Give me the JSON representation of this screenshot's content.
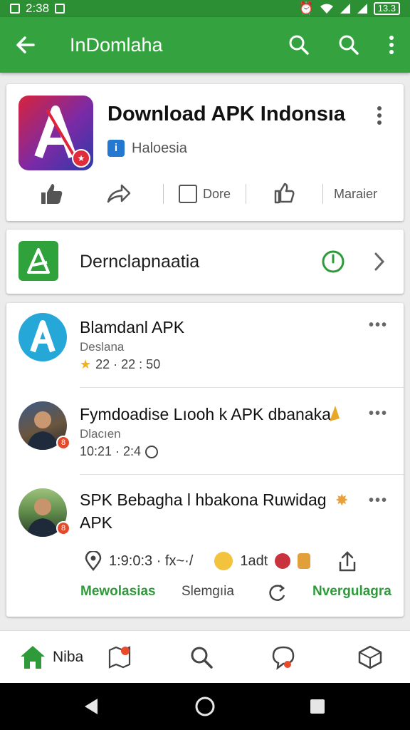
{
  "status_bar": {
    "time": "2:38",
    "battery": "13.3"
  },
  "app_bar": {
    "title": "InDomlaha"
  },
  "app_card": {
    "title": "Download APK Indonsıa",
    "subtitle": "Haloesia",
    "actions": [
      {
        "label": "Dore"
      },
      {
        "label": "Maraier"
      }
    ]
  },
  "link_row": {
    "label": "Dernclapnaatia"
  },
  "feed": [
    {
      "title": "Blamdanl APK",
      "subtitle": "Deslana",
      "meta": "22 · 22 : 50"
    },
    {
      "title": "Fymdoadise Lıooh k APK dbanaka",
      "subtitle": "Dlacıen",
      "meta": "10:21 · 2:4"
    },
    {
      "title": "SPK Bebagha l hbakona Ruwidag APK",
      "location": "1:9:0:3 · fx~·/",
      "tag": "1adt",
      "buttons": {
        "left": "Mewolasias",
        "middle": "Slemgıia",
        "right": "Nvergulagra"
      }
    }
  ],
  "bottom_nav": {
    "home_label": "Niba"
  },
  "colors": {
    "primary": "#34a33f",
    "status": "#2c8f33",
    "accent_green": "#2e9a3a"
  }
}
